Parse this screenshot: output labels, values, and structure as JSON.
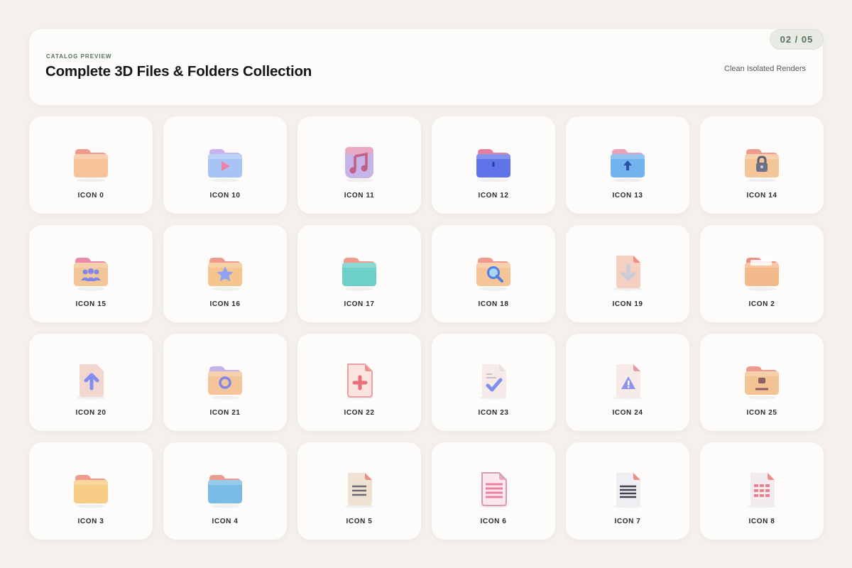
{
  "header": {
    "eyebrow": "CATALOG PREVIEW",
    "title": "Complete 3D Files & Folders Collection",
    "page": "02 / 05",
    "subtitle": "Clean Isolated Renders"
  },
  "icons": [
    {
      "label": "ICON 0",
      "icon": "folder-peach-icon"
    },
    {
      "label": "ICON 10",
      "icon": "folder-video-icon"
    },
    {
      "label": "ICON 11",
      "icon": "music-note-icon"
    },
    {
      "label": "ICON 12",
      "icon": "folder-blue-icon"
    },
    {
      "label": "ICON 13",
      "icon": "folder-upload-icon"
    },
    {
      "label": "ICON 14",
      "icon": "folder-lock-icon"
    },
    {
      "label": "ICON 15",
      "icon": "folder-users-icon"
    },
    {
      "label": "ICON 16",
      "icon": "folder-star-icon"
    },
    {
      "label": "ICON 17",
      "icon": "folder-teal-icon"
    },
    {
      "label": "ICON 18",
      "icon": "folder-search-icon"
    },
    {
      "label": "ICON 19",
      "icon": "file-download-icon"
    },
    {
      "label": "ICON 2",
      "icon": "folder-documents-icon"
    },
    {
      "label": "ICON 20",
      "icon": "file-upload-icon"
    },
    {
      "label": "ICON 21",
      "icon": "folder-sync-icon"
    },
    {
      "label": "ICON 22",
      "icon": "file-add-icon"
    },
    {
      "label": "ICON 23",
      "icon": "file-check-icon"
    },
    {
      "label": "ICON 24",
      "icon": "file-warning-icon"
    },
    {
      "label": "ICON 25",
      "icon": "folder-user-icon"
    },
    {
      "label": "ICON 3",
      "icon": "folder-yellow-icon"
    },
    {
      "label": "ICON 4",
      "icon": "folder-sky-icon"
    },
    {
      "label": "ICON 5",
      "icon": "document-text-icon"
    },
    {
      "label": "ICON 6",
      "icon": "document-pink-lines-icon"
    },
    {
      "label": "ICON 7",
      "icon": "document-lines-icon"
    },
    {
      "label": "ICON 8",
      "icon": "spreadsheet-icon"
    }
  ]
}
